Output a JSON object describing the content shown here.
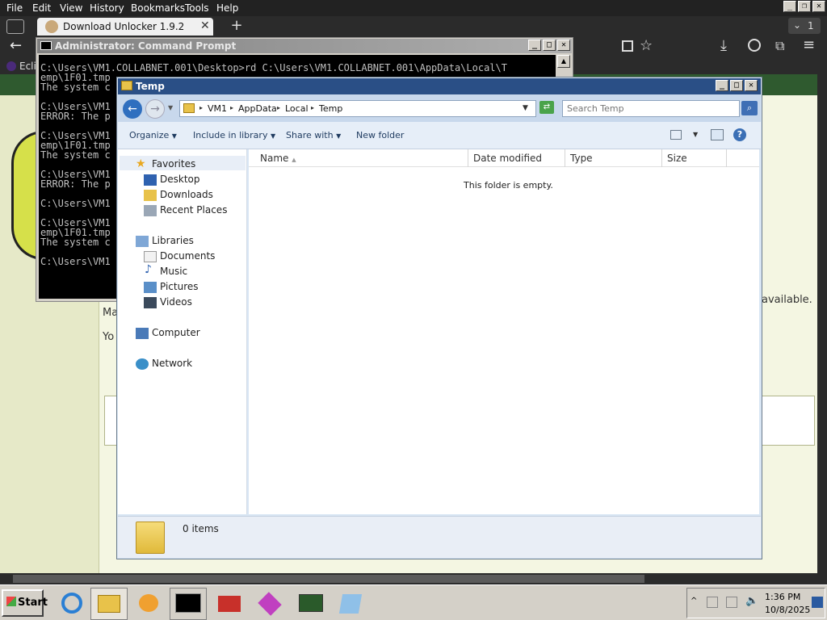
{
  "browser": {
    "menu": [
      "File",
      "Edit",
      "View",
      "History",
      "Bookmarks",
      "Tools",
      "Help"
    ],
    "tab_title": "Download Unlocker 1.9.2",
    "tab_overflow_count": "1",
    "bookmark_partial": "Ecli"
  },
  "webpage": {
    "partial_left_1": "Ma",
    "partial_left_2": "Yo",
    "partial_right": "available."
  },
  "cmd": {
    "title": "Administrator: Command Prompt",
    "lines": [
      "C:\\Users\\VM1.COLLABNET.001\\Desktop>rd C:\\Users\\VM1.COLLABNET.001\\AppData\\Local\\T",
      "emp\\1F01.tmp",
      "The system c",
      "",
      "C:\\Users\\VM1",
      "ERROR: The p",
      "",
      "C:\\Users\\VM1",
      "emp\\1F01.tmp",
      "The system c",
      "",
      "C:\\Users\\VM1",
      "ERROR: The p",
      "",
      "C:\\Users\\VM1",
      "",
      "C:\\Users\\VM1",
      "emp\\1F01.tmp",
      "The system c",
      "",
      "C:\\Users\\VM1"
    ]
  },
  "explorer": {
    "title": "Temp",
    "breadcrumb": [
      "VM1",
      "AppData",
      "Local",
      "Temp"
    ],
    "search_placeholder": "Search Temp",
    "toolbar": {
      "organize": "Organize",
      "include_in_library": "Include in library",
      "share_with": "Share with",
      "new_folder": "New folder"
    },
    "nav": {
      "favorites": "Favorites",
      "desktop": "Desktop",
      "downloads": "Downloads",
      "recent_places": "Recent Places",
      "libraries": "Libraries",
      "documents": "Documents",
      "music": "Music",
      "pictures": "Pictures",
      "videos": "Videos",
      "computer": "Computer",
      "network": "Network"
    },
    "columns": [
      "Name",
      "Date modified",
      "Type",
      "Size"
    ],
    "empty_message": "This folder is empty.",
    "status": "0 items"
  },
  "taskbar": {
    "start": "Start",
    "time": "1:36 PM",
    "date": "10/8/2025"
  }
}
